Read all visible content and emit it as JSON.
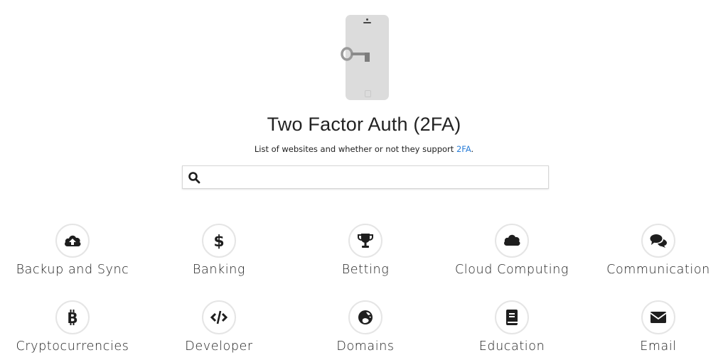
{
  "header": {
    "logo_icon": "phone-with-key-icon",
    "title": "Two Factor Auth (2FA)",
    "subtitle_prefix": "List of websites and whether or not they support ",
    "subtitle_link": "2FA",
    "subtitle_suffix": ".",
    "link_color": "#2a7ed8"
  },
  "search": {
    "icon": "search-icon",
    "value": "",
    "placeholder": ""
  },
  "categories": [
    {
      "label": "Backup and Sync",
      "icon": "cloud-upload-icon"
    },
    {
      "label": "Banking",
      "icon": "dollar-icon"
    },
    {
      "label": "Betting",
      "icon": "trophy-icon"
    },
    {
      "label": "Cloud Computing",
      "icon": "cloud-icon"
    },
    {
      "label": "Communication",
      "icon": "comments-icon"
    },
    {
      "label": "Cryptocurrencies",
      "icon": "bitcoin-icon"
    },
    {
      "label": "Developer",
      "icon": "code-icon"
    },
    {
      "label": "Domains",
      "icon": "globe-icon"
    },
    {
      "label": "Education",
      "icon": "book-icon"
    },
    {
      "label": "Email",
      "icon": "envelope-icon"
    }
  ]
}
